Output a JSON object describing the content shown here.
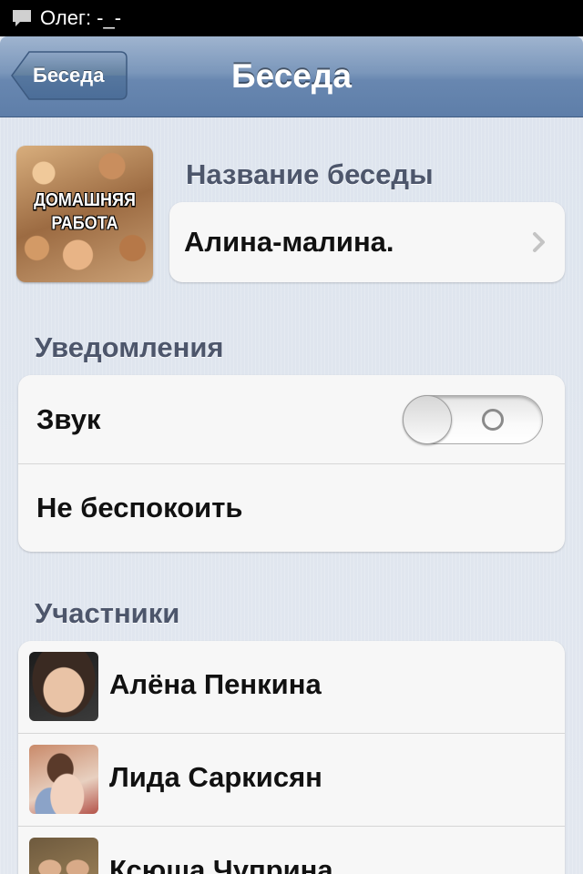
{
  "status_bar": {
    "icon": "chat-bubble-icon",
    "text": "Олег: -_-"
  },
  "nav": {
    "back_label": "Беседа",
    "title": "Беседа"
  },
  "chat": {
    "avatar_caption_line1": "ДОМАШНЯЯ",
    "avatar_caption_line2": "РАБОТА",
    "name_section_label": "Название беседы",
    "name_value": "Алина-малина."
  },
  "notifications": {
    "section_label": "Уведомления",
    "sound_label": "Звук",
    "sound_on": false,
    "dnd_label": "Не беспокоить"
  },
  "members": {
    "section_label": "Участники",
    "items": [
      {
        "name": "Алёна Пенкина"
      },
      {
        "name": "Лида Саркисян"
      },
      {
        "name": "Ксюша Чуприна"
      }
    ]
  },
  "colors": {
    "navbar": "#6887b0",
    "background": "#dfe5ee",
    "section_label": "#4d566b",
    "card": "#f7f7f7"
  }
}
